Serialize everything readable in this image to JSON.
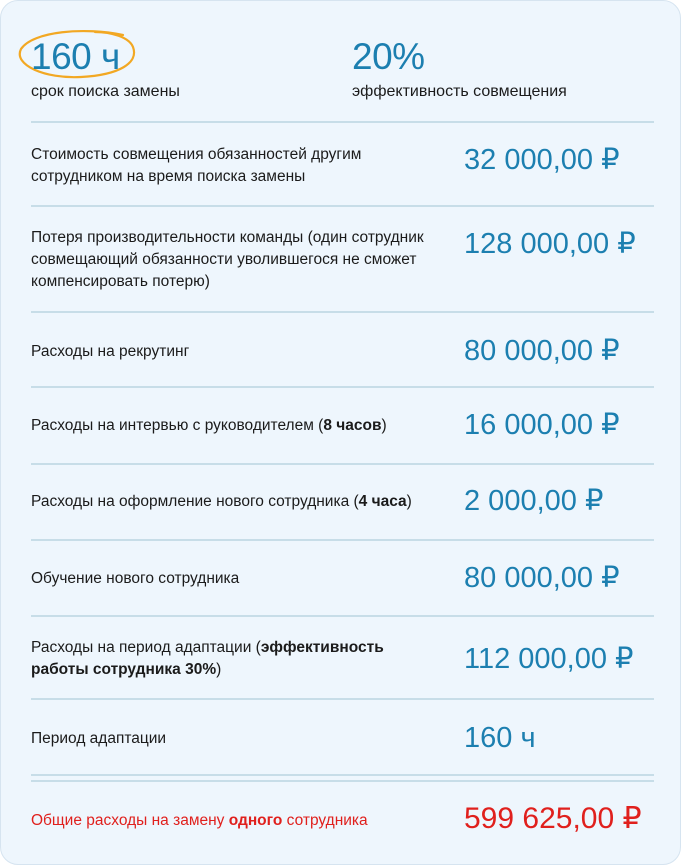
{
  "header": {
    "search_time": {
      "value": "160 ч",
      "label": "срок поиска замены"
    },
    "combination_efficiency": {
      "value": "20%",
      "label": "эффективность совмещения"
    }
  },
  "rows": [
    {
      "label_parts": [
        "Стоимость совмещения обязанностей другим сотрудником на время поиска замены"
      ],
      "value": "32 000,00 ₽"
    },
    {
      "label_parts": [
        "Потеря производительности команды (один сотрудник совмещающий обязанности уволившегося не сможет компенсировать потерю)"
      ],
      "value": "128 000,00 ₽"
    },
    {
      "label_parts": [
        "Расходы на рекрутинг"
      ],
      "value": "80 000,00 ₽"
    },
    {
      "label_parts": [
        "Расходы на интервью с руководителем (",
        "8 часов",
        ")"
      ],
      "value": "16 000,00 ₽"
    },
    {
      "label_parts": [
        "Расходы на оформление нового сотрудника (",
        "4 часа",
        ")"
      ],
      "value": "2 000,00 ₽"
    },
    {
      "label_parts": [
        "Обучение нового сотрудника"
      ],
      "value": "80 000,00 ₽"
    },
    {
      "label_parts": [
        "Расходы на период адаптации (",
        "эффективность работы сотрудника 30%",
        ")"
      ],
      "value": "112 000,00 ₽"
    },
    {
      "label_parts": [
        "Период адаптации"
      ],
      "value": "160 ч"
    }
  ],
  "total": {
    "label_parts": [
      "Общие расходы на замену ",
      "одного",
      " сотрудника"
    ],
    "value": "599 625,00 ₽"
  },
  "colors": {
    "accent": "#1c7fb0",
    "total": "#e0201d",
    "highlight": "#f2a823",
    "background": "#eef6fd"
  }
}
